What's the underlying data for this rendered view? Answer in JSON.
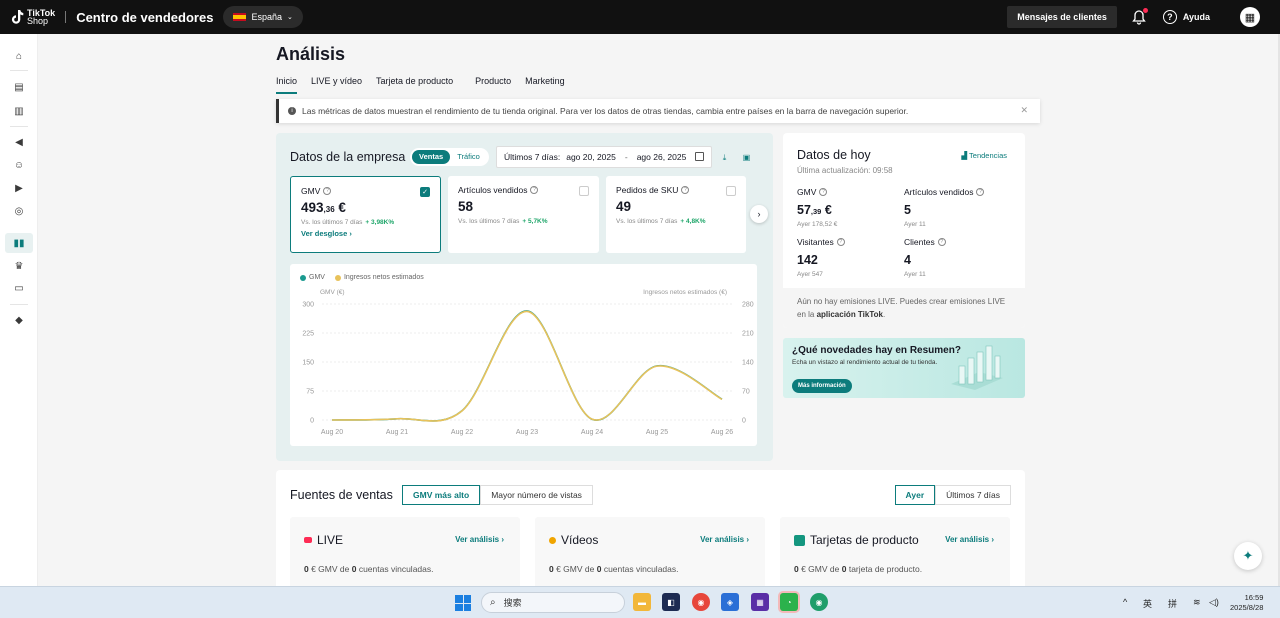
{
  "topbar": {
    "logo_text_1": "TikTok",
    "logo_text_2": "Shop",
    "title": "Centro de vendedores",
    "country": "España",
    "messages": "Mensajes de clientes",
    "help": "Ayuda"
  },
  "page": {
    "title": "Análisis",
    "tabs": [
      "Inicio",
      "LIVE y vídeo",
      "Tarjeta de producto",
      "Producto",
      "Marketing"
    ],
    "notice": "Las métricas de datos muestran el rendimiento de tu tienda original. Para ver los datos de otras tiendas, cambia entre países en la barra de navegación superior."
  },
  "company": {
    "title": "Datos de la empresa",
    "toggle_on": "Ventas",
    "toggle_off": "Tráfico",
    "date_label": "Últimos 7 días:",
    "date_start": "ago 20, 2025",
    "date_sep": "-",
    "date_end": "ago 26, 2025",
    "metrics": [
      {
        "label": "GMV",
        "value_main": "493",
        "value_dec": ",36",
        "value_unit": " €",
        "vs": "Vs. los últimos 7 días",
        "change": "+ 3,98K%",
        "link": "Ver desglose ›"
      },
      {
        "label": "Artículos vendidos",
        "value_main": "58",
        "vs": "Vs. los últimos 7 días",
        "change": "+ 5,7K%"
      },
      {
        "label": "Pedidos de SKU",
        "value_main": "49",
        "vs": "Vs. los últimos 7 días",
        "change": "+ 4,8K%"
      }
    ]
  },
  "chart_data": {
    "type": "line",
    "x": [
      "Aug 20",
      "Aug 21",
      "Aug 22",
      "Aug 23",
      "Aug 24",
      "Aug 25",
      "Aug 26"
    ],
    "series": [
      {
        "name": "GMV",
        "values": [
          0,
          3,
          24,
          282,
          2,
          140,
          54
        ],
        "color": "#1a9a8f"
      },
      {
        "name": "Ingresos netos estimados",
        "values": [
          0,
          3,
          22,
          262,
          2,
          130,
          50
        ],
        "color": "#e8c25b"
      }
    ],
    "ylabel_left": "GMV (€)",
    "ylabel_right": "Ingresos netos estimados (€)",
    "yticks_left": [
      "0",
      "75",
      "150",
      "225",
      "300"
    ],
    "yticks_right": [
      "0",
      "70",
      "140",
      "210",
      "280"
    ],
    "ylim_left": [
      0,
      300
    ],
    "ylim_right": [
      0,
      280
    ],
    "grid": true,
    "legend": "top-left"
  },
  "today": {
    "title": "Datos de hoy",
    "updated": "Última actualización: 09:58",
    "trends": "Tendencias",
    "metrics": [
      {
        "label": "GMV",
        "value_main": "57",
        "value_dec": ",39",
        "value_unit": " €",
        "sub": "Ayer 178,52 €"
      },
      {
        "label": "Artículos vendidos",
        "value_main": "5",
        "sub": "Ayer 11"
      },
      {
        "label": "Visitantes",
        "value_main": "142",
        "sub": "Ayer 547"
      },
      {
        "label": "Clientes",
        "value_main": "4",
        "sub": "Ayer 11"
      }
    ],
    "footer_text": "Aún no hay emisiones LIVE. Puedes crear emisiones LIVE en la ",
    "footer_bold": "aplicación TikTok",
    "footer_end": "."
  },
  "promo": {
    "title": "¿Qué novedades hay en Resumen?",
    "subtitle": "Echa un vistazo al rendimiento actual de tu tienda.",
    "button": "Más información"
  },
  "sources": {
    "title": "Fuentes de ventas",
    "seg_left": [
      "GMV más alto",
      "Mayor número de vistas"
    ],
    "seg_right": [
      "Ayer",
      "Últimos 7 días"
    ],
    "cards": [
      {
        "title": "LIVE",
        "link": "Ver análisis ›",
        "line_pre": "0",
        "line_mid": " € GMV de ",
        "line_num": "0",
        "line_end": " cuentas vinculadas."
      },
      {
        "title": "Vídeos",
        "link": "Ver análisis ›",
        "line_pre": "0",
        "line_mid": " € GMV de ",
        "line_num": "0",
        "line_end": " cuentas vinculadas."
      },
      {
        "title": "Tarjetas de producto",
        "link": "Ver análisis ›",
        "line_pre": "0",
        "line_mid": " € GMV de ",
        "line_num": "0",
        "line_end": " tarjeta de producto."
      }
    ]
  },
  "taskbar": {
    "search": "搜索",
    "ime_1": "英",
    "ime_2": "拼",
    "time": "16:59",
    "date": "2025/8/28"
  }
}
